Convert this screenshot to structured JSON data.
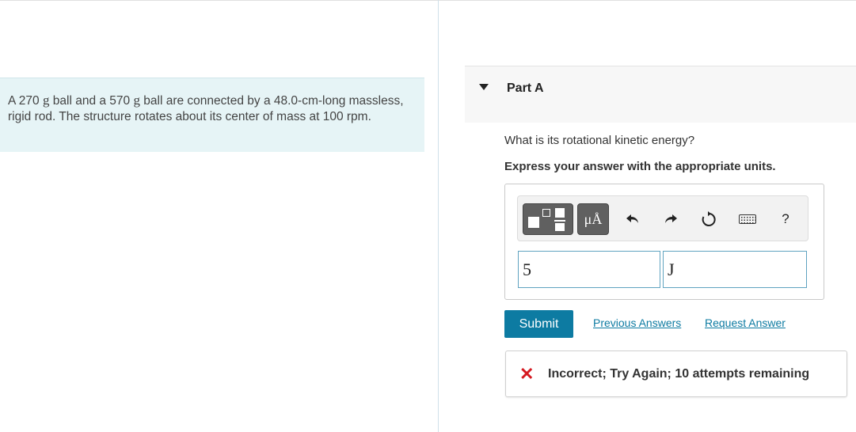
{
  "problem": {
    "text_before_m1": "A 270 ",
    "unit_g1": "g",
    "text_mid": " ball and a 570 ",
    "unit_g2": "g",
    "text_after": " ball are connected by a 48.0-cm-long massless, rigid rod. The structure rotates about its center of mass at 100 rpm."
  },
  "part": {
    "title": "Part A"
  },
  "question": "What is its rotational kinetic energy?",
  "instruction": "Express your answer with the appropriate units.",
  "toolbar": {
    "units_label": "μÅ",
    "help_label": "?",
    "icons": [
      "templates-icon",
      "units-icon",
      "undo-icon",
      "redo-icon",
      "reset-icon",
      "keyboard-icon",
      "help-icon"
    ]
  },
  "answer": {
    "value": "5",
    "unit": "J"
  },
  "actions": {
    "submit_label": "Submit",
    "previous_answers_label": "Previous Answers",
    "request_answer_label": "Request Answer"
  },
  "feedback": {
    "message": "Incorrect; Try Again; 10 attempts remaining"
  },
  "colors": {
    "accent": "#0d7ba2",
    "error": "#d51920",
    "problem_bg": "#e6f4f6"
  }
}
